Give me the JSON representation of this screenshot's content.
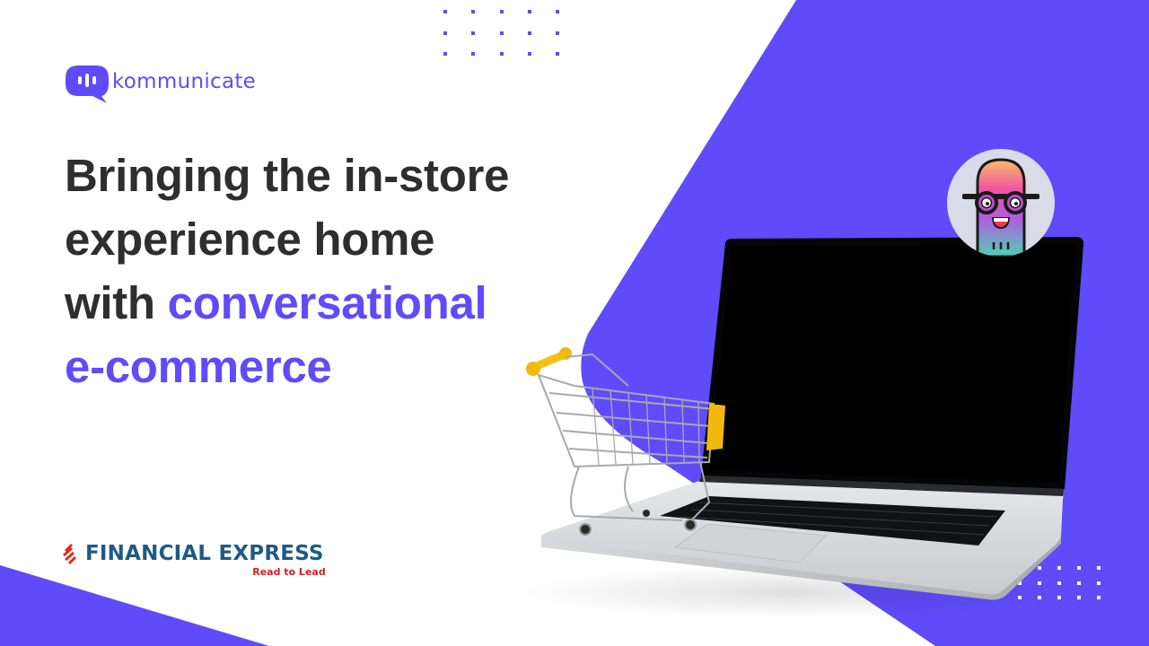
{
  "brand": {
    "name": "kommunicate",
    "logo_icon": "chat-bubble-icon",
    "accent_color": "#5f4bfa"
  },
  "headline": {
    "lines": [
      {
        "text": "Bringing the in-store",
        "accent": ""
      },
      {
        "text": "experience home",
        "accent": ""
      },
      {
        "text": "with ",
        "accent": "conversational"
      },
      {
        "text": "",
        "accent": "e-commerce"
      }
    ],
    "text_color": "#2e2e30"
  },
  "partner": {
    "name": "FINANCIAL EXPRESS",
    "tagline": "Read to Lead",
    "icon": "financial-express-logo-icon",
    "name_color": "#1f5a86",
    "tagline_color": "#d21f26"
  },
  "illustration": {
    "laptop": "laptop-icon",
    "cart": "shopping-cart-icon",
    "mascot": "bot-mascot-avatar"
  },
  "colors": {
    "background": "#ffffff",
    "purple_shape": "#5f4bfa"
  }
}
